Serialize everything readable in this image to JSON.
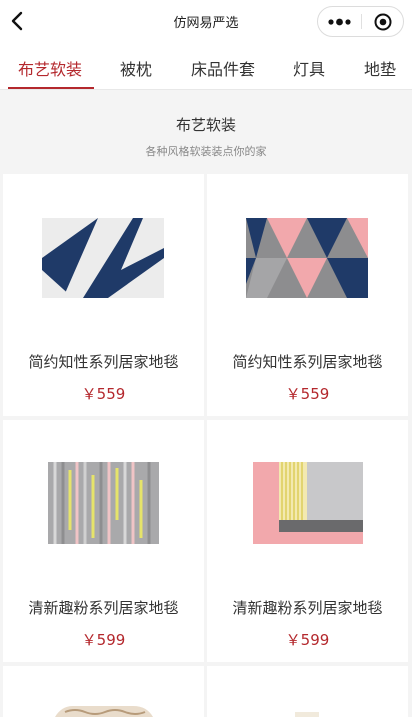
{
  "navbar": {
    "title": "仿网易严选",
    "back_icon": "chevron-left-icon",
    "more_icon": "more-dots-icon",
    "close_icon": "target-close-icon"
  },
  "tabs": [
    {
      "label": "布艺软装",
      "active": true
    },
    {
      "label": "被枕",
      "active": false
    },
    {
      "label": "床品件套",
      "active": false
    },
    {
      "label": "灯具",
      "active": false
    },
    {
      "label": "地垫",
      "active": false
    }
  ],
  "section": {
    "title": "布艺软装",
    "subtitle": "各种风格软装装点你的家"
  },
  "products": [
    {
      "name": "简约知性系列居家地毯",
      "price": "￥559"
    },
    {
      "name": "简约知性系列居家地毯",
      "price": "￥559"
    },
    {
      "name": "清新趣粉系列居家地毯",
      "price": "￥599"
    },
    {
      "name": "清新趣粉系列居家地毯",
      "price": "￥599"
    }
  ],
  "colors": {
    "accent": "#b4282d",
    "background": "#f4f4f4",
    "navy": "#1f3a68",
    "pink": "#f2a8ac",
    "gray": "#8d8d8f"
  }
}
